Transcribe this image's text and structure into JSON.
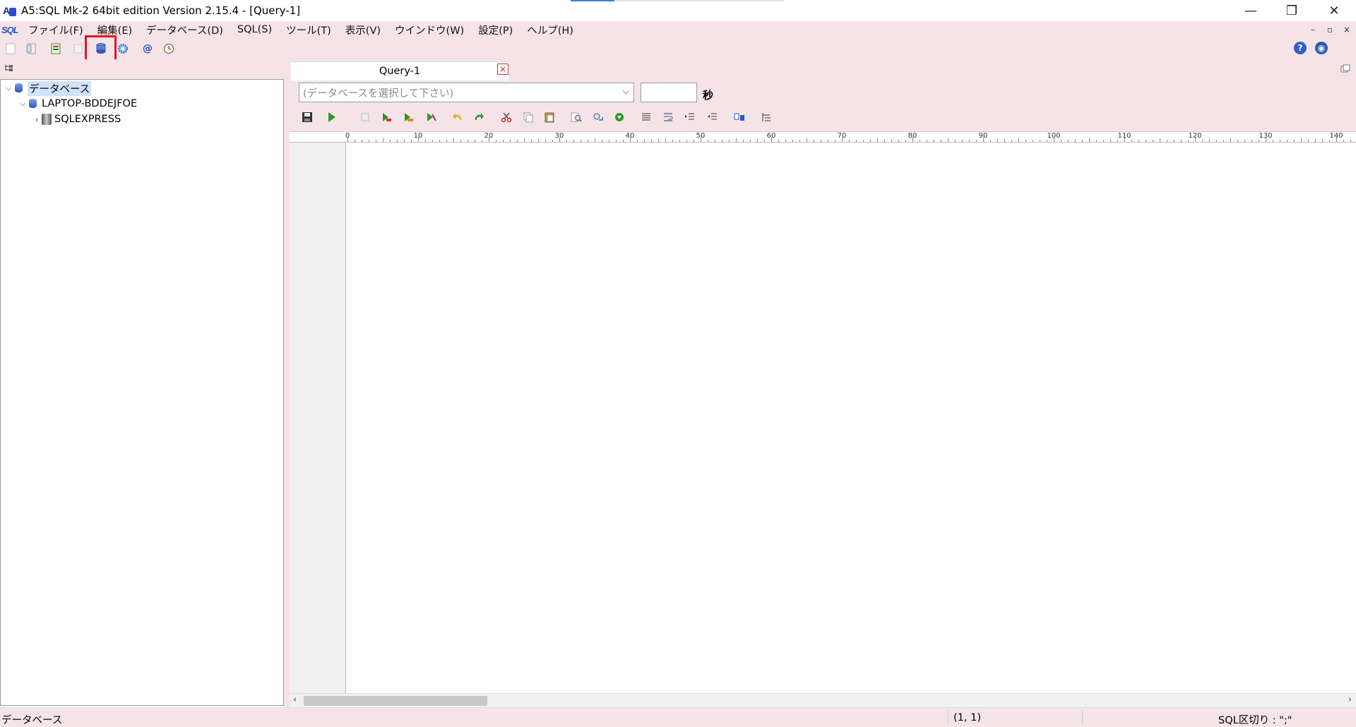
{
  "window": {
    "title": "A5:SQL Mk-2 64bit edition Version 2.15.4 - [Query-1]",
    "minimize": "—",
    "restore": "❐",
    "close": "✕"
  },
  "menubar": {
    "logo": "SQL",
    "items": [
      "ファイル(F)",
      "編集(E)",
      "データベース(D)",
      "SQL(S)",
      "ツール(T)",
      "表示(V)",
      "ウインドウ(W)",
      "設定(P)",
      "ヘルプ(H)"
    ],
    "mdi_min": "–",
    "mdi_restore": "▫",
    "mdi_close": "×"
  },
  "toolbar": {
    "icons": [
      "new-icon",
      "open-icon",
      "export-icon",
      "copy-disabled-icon",
      "database-connect-icon",
      "settings-gear-icon",
      "at-sign-icon",
      "clock-icon"
    ],
    "help": "?",
    "web": "◉"
  },
  "tree": {
    "root": "データベース",
    "server": "LAPTOP-BDDEJFOE",
    "instance": "SQLEXPRESS"
  },
  "query_tab": {
    "label": "Query-1",
    "close": "×"
  },
  "editor_toolbar": {
    "db_placeholder": "(データベースを選択して下さい)",
    "timeout_value": "",
    "seconds_label": "秒"
  },
  "ruler": {
    "labels": [
      "0",
      "10",
      "20",
      "30",
      "40",
      "50",
      "60",
      "70",
      "80",
      "90",
      "100",
      "110",
      "120",
      "130",
      "140"
    ]
  },
  "statusbar": {
    "left": "データベース",
    "position": "(1, 1)",
    "delimiter": "SQL区切り : \";\""
  },
  "colors": {
    "chrome": "#f5e4e7",
    "highlight": "#e4131f"
  }
}
